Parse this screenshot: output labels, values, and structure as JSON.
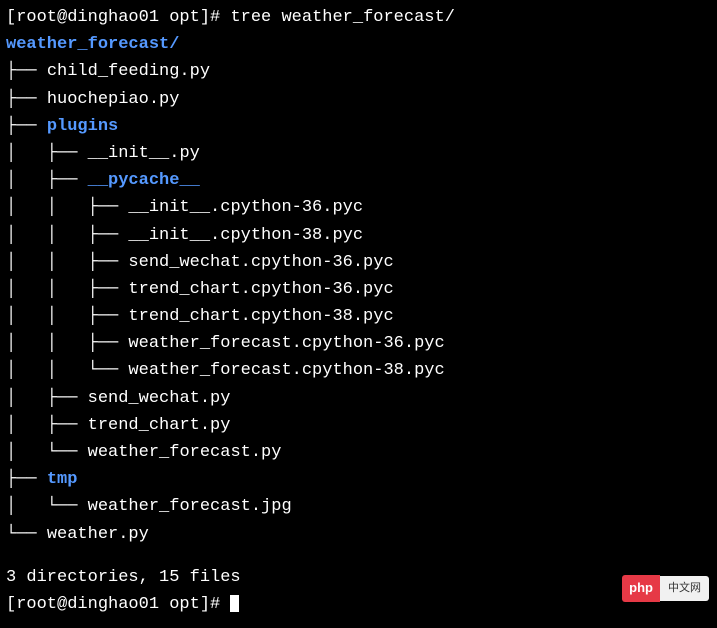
{
  "prompt": {
    "user_host": "[root@dinghao01 opt]#",
    "command": "tree weather_forecast/"
  },
  "tree": {
    "root": "weather_forecast/",
    "lines": [
      {
        "prefix": "├── ",
        "name": "child_feeding.py",
        "type": "file"
      },
      {
        "prefix": "├── ",
        "name": "huochepiao.py",
        "type": "file"
      },
      {
        "prefix": "├── ",
        "name": "plugins",
        "type": "dir"
      },
      {
        "prefix": "│   ├── ",
        "name": "__init__.py",
        "type": "file"
      },
      {
        "prefix": "│   ├── ",
        "name": "__pycache__",
        "type": "dir"
      },
      {
        "prefix": "│   │   ├── ",
        "name": "__init__.cpython-36.pyc",
        "type": "file"
      },
      {
        "prefix": "│   │   ├── ",
        "name": "__init__.cpython-38.pyc",
        "type": "file"
      },
      {
        "prefix": "│   │   ├── ",
        "name": "send_wechat.cpython-36.pyc",
        "type": "file"
      },
      {
        "prefix": "│   │   ├── ",
        "name": "trend_chart.cpython-36.pyc",
        "type": "file"
      },
      {
        "prefix": "│   │   ├── ",
        "name": "trend_chart.cpython-38.pyc",
        "type": "file"
      },
      {
        "prefix": "│   │   ├── ",
        "name": "weather_forecast.cpython-36.pyc",
        "type": "file"
      },
      {
        "prefix": "│   │   └── ",
        "name": "weather_forecast.cpython-38.pyc",
        "type": "file"
      },
      {
        "prefix": "│   ├── ",
        "name": "send_wechat.py",
        "type": "file"
      },
      {
        "prefix": "│   ├── ",
        "name": "trend_chart.py",
        "type": "file"
      },
      {
        "prefix": "│   └── ",
        "name": "weather_forecast.py",
        "type": "file"
      },
      {
        "prefix": "├── ",
        "name": "tmp",
        "type": "dir"
      },
      {
        "prefix": "│   └── ",
        "name": "weather_forecast.jpg",
        "type": "file"
      },
      {
        "prefix": "└── ",
        "name": "weather.py",
        "type": "file"
      }
    ]
  },
  "summary": "3 directories, 15 files",
  "next_prompt": "[root@dinghao01 opt]# ",
  "watermark": {
    "brand": "php",
    "suffix": "中文网"
  }
}
